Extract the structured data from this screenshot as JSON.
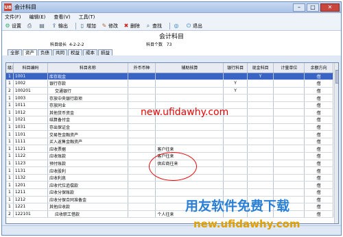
{
  "window": {
    "title": "会计科目",
    "app_icon": "U8"
  },
  "menu": [
    "文件(F)",
    "编辑(E)",
    "查看(V)",
    "工具(T)"
  ],
  "toolbar": [
    {
      "icon": "setup-icon",
      "label": "设置"
    },
    {
      "icon": "print-icon",
      "label": ""
    },
    {
      "icon": "preview-icon",
      "label": ""
    },
    {
      "icon": "export-icon",
      "label": "输出"
    },
    {
      "icon": "add-icon",
      "label": "增加"
    },
    {
      "icon": "edit-icon",
      "label": "修改"
    },
    {
      "icon": "delete-icon",
      "label": "删除"
    },
    {
      "icon": "find-icon",
      "label": "查找"
    },
    {
      "icon": "help-icon",
      "label": ""
    },
    {
      "icon": "exit-icon",
      "label": "退出"
    }
  ],
  "header": {
    "title": "会计科目",
    "code_rule_label": "科目级长",
    "code_rule": "4-2-2-2",
    "count_label": "科目个数",
    "count": "73"
  },
  "tabs": [
    "全部",
    "资产",
    "负债",
    "共同",
    "权益",
    "成本",
    "损益"
  ],
  "active_tab": "资产",
  "columns": [
    "级次",
    "科目编码",
    "科目名称",
    "外币币种",
    "辅助核算",
    "银行科目",
    "现金科目",
    "计量单位",
    "余额方向"
  ],
  "rows": [
    {
      "level": "1",
      "code": "1001",
      "name": "库存现金",
      "cur": "",
      "aux": "",
      "bank": "",
      "cash": "Y",
      "unit": "",
      "dir": "借",
      "sel": true
    },
    {
      "level": "1",
      "code": "1002",
      "name": "银行存款",
      "cur": "",
      "aux": "",
      "bank": "Y",
      "cash": "",
      "unit": "",
      "dir": "借"
    },
    {
      "level": "2",
      "code": "100201",
      "name": "交通银行",
      "cur": "",
      "aux": "",
      "bank": "Y",
      "cash": "",
      "unit": "",
      "dir": "借",
      "indent": true
    },
    {
      "level": "1",
      "code": "1003",
      "name": "存放中央银行款项",
      "cur": "",
      "aux": "",
      "bank": "",
      "cash": "",
      "unit": "",
      "dir": "借"
    },
    {
      "level": "1",
      "code": "1011",
      "name": "存放同业",
      "cur": "",
      "aux": "",
      "bank": "",
      "cash": "",
      "unit": "",
      "dir": "借"
    },
    {
      "level": "1",
      "code": "1012",
      "name": "其他货币资金",
      "cur": "",
      "aux": "",
      "bank": "",
      "cash": "",
      "unit": "",
      "dir": "借"
    },
    {
      "level": "1",
      "code": "1021",
      "name": "结算备付金",
      "cur": "",
      "aux": "",
      "bank": "",
      "cash": "",
      "unit": "",
      "dir": "借"
    },
    {
      "level": "1",
      "code": "1031",
      "name": "存出保证金",
      "cur": "",
      "aux": "",
      "bank": "",
      "cash": "",
      "unit": "",
      "dir": "借"
    },
    {
      "level": "1",
      "code": "1101",
      "name": "交易性金融资产",
      "cur": "",
      "aux": "",
      "bank": "",
      "cash": "",
      "unit": "",
      "dir": "借"
    },
    {
      "level": "1",
      "code": "1111",
      "name": "买入返售金融资产",
      "cur": "",
      "aux": "",
      "bank": "",
      "cash": "",
      "unit": "",
      "dir": "借"
    },
    {
      "level": "1",
      "code": "1121",
      "name": "应收票据",
      "cur": "",
      "aux": "客户往来",
      "bank": "",
      "cash": "",
      "unit": "",
      "dir": "借"
    },
    {
      "level": "1",
      "code": "1122",
      "name": "应收账款",
      "cur": "",
      "aux": "客户往来",
      "bank": "",
      "cash": "",
      "unit": "",
      "dir": "借"
    },
    {
      "level": "1",
      "code": "1123",
      "name": "预付账款",
      "cur": "",
      "aux": "供应商往来",
      "bank": "",
      "cash": "",
      "unit": "",
      "dir": "借"
    },
    {
      "level": "1",
      "code": "1131",
      "name": "应收股利",
      "cur": "",
      "aux": "",
      "bank": "",
      "cash": "",
      "unit": "",
      "dir": "借"
    },
    {
      "level": "1",
      "code": "1132",
      "name": "应收利息",
      "cur": "",
      "aux": "",
      "bank": "",
      "cash": "",
      "unit": "",
      "dir": "借"
    },
    {
      "level": "1",
      "code": "1201",
      "name": "应收代位追偿款",
      "cur": "",
      "aux": "",
      "bank": "",
      "cash": "",
      "unit": "",
      "dir": "借"
    },
    {
      "level": "1",
      "code": "1211",
      "name": "应收分保账款",
      "cur": "",
      "aux": "",
      "bank": "",
      "cash": "",
      "unit": "",
      "dir": "借"
    },
    {
      "level": "1",
      "code": "1212",
      "name": "应收分保合同准备金",
      "cur": "",
      "aux": "",
      "bank": "",
      "cash": "",
      "unit": "",
      "dir": "借"
    },
    {
      "level": "1",
      "code": "1221",
      "name": "其他应收款",
      "cur": "",
      "aux": "",
      "bank": "",
      "cash": "",
      "unit": "",
      "dir": "借"
    },
    {
      "level": "2",
      "code": "122101",
      "name": "应收职工借款",
      "cur": "",
      "aux": "个人往来",
      "bank": "",
      "cash": "",
      "unit": "",
      "dir": "借",
      "indent": true
    }
  ],
  "watermarks": {
    "url_red": "new.ufidawhy.com",
    "brand": "用友软件免费下载",
    "url_bottom": "new.ufidawhy.com"
  },
  "colors": {
    "selection": "#3a63c6",
    "highlight_circle": "#e00000",
    "brand_blue": "#2a7fd6",
    "url_gold": "#e0a000"
  }
}
